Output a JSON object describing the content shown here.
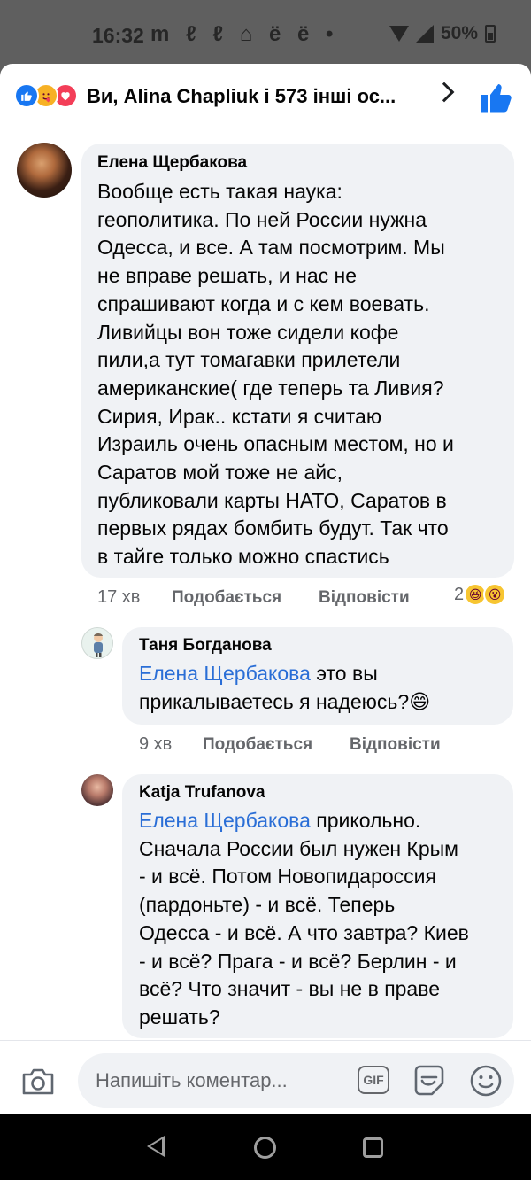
{
  "status_bar": {
    "time": "16:32",
    "notif_icons": "m ℓ ℓ ⌂ ё ё •",
    "battery": "50%"
  },
  "reactions_header": {
    "text": "Ви, Alina Chapliuk і 573 інші ос...",
    "icons": [
      "like-icon",
      "care-icon",
      "love-icon"
    ]
  },
  "comments": [
    {
      "author": "Елена Щербакова",
      "text_lines": [
        "Вообще есть такая наука:",
        "геополитика. По ней России нужна",
        "Одесса, и все. А там посмотрим. Мы",
        "не вправе решать, и нас не",
        "спрашивают когда и с кем воевать.",
        "Ливийцы вон тоже сидели кофе",
        "пили,а тут томагавки прилетели",
        "американские( где теперь та Ливия?",
        "Сирия, Ирак.. кстати я считаю",
        "Израиль очень опасным местом, но и",
        "Саратов мой тоже не айс,",
        "публиковали карты НАТО, Саратов в",
        "первых рядах бомбить будут. Так что",
        "в тайге только можно спастись"
      ],
      "time": "17 хв",
      "like_label": "Подобається",
      "reply_label": "Відповісти",
      "reaction_count": "2",
      "reaction_emojis": [
        "😆",
        "😮"
      ]
    },
    {
      "author": "Таня Богданова",
      "mention": "Елена Щербакова",
      "line1_rest": " это вы",
      "line2": "прикалываетесь я надеюсь?😄",
      "time": "9 хв",
      "like_label": "Подобається",
      "reply_label": "Відповісти"
    },
    {
      "author": "Katja Trufanova",
      "mention": "Елена Щербакова",
      "line1_rest": " прикольно.",
      "text_lines": [
        "Сначала России был нужен Крым",
        "- и всё. Потом Новопидароссия",
        "(пардоньте) - и всё. Теперь",
        "Одесса - и всё. А что завтра? Киев",
        "- и всё? Прага - и всё? Берлин - и",
        "всё? Что значит - вы не в праве",
        "решать?"
      ]
    }
  ],
  "composer": {
    "placeholder": "Напишіть коментар...",
    "gif_label": "GIF"
  },
  "colors": {
    "facebook_blue": "#1877f2",
    "mention_blue": "#2a6ed6",
    "bubble_bg": "#f0f2f5",
    "meta_gray": "#65676b"
  }
}
